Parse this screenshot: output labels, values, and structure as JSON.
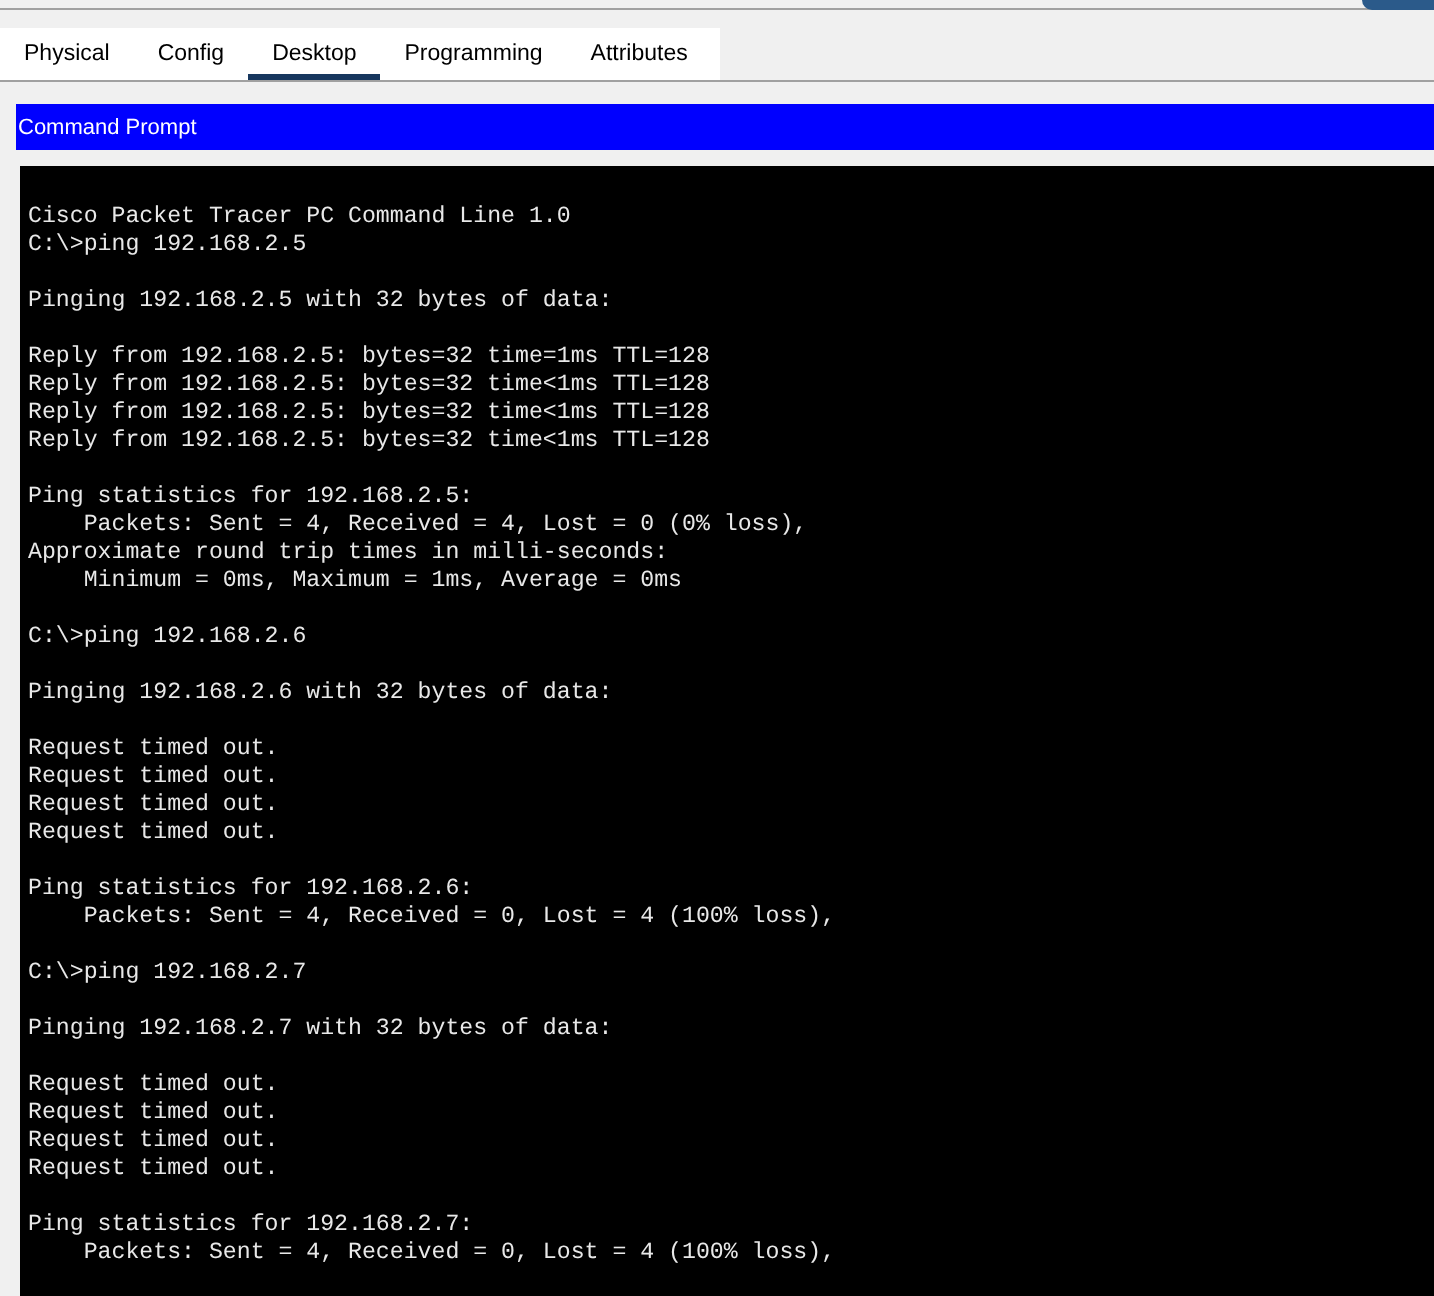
{
  "tabs": [
    {
      "label": "Physical",
      "selected": false
    },
    {
      "label": "Config",
      "selected": false
    },
    {
      "label": "Desktop",
      "selected": true
    },
    {
      "label": "Programming",
      "selected": false
    },
    {
      "label": "Attributes",
      "selected": false
    }
  ],
  "panel": {
    "title": "Command Prompt"
  },
  "terminal": {
    "blocks": [
      [
        "Cisco Packet Tracer PC Command Line 1.0",
        "C:\\>ping 192.168.2.5"
      ],
      [
        "Pinging 192.168.2.5 with 32 bytes of data:"
      ],
      [
        "Reply from 192.168.2.5: bytes=32 time=1ms TTL=128",
        "Reply from 192.168.2.5: bytes=32 time<1ms TTL=128",
        "Reply from 192.168.2.5: bytes=32 time<1ms TTL=128",
        "Reply from 192.168.2.5: bytes=32 time<1ms TTL=128"
      ],
      [
        "Ping statistics for 192.168.2.5:",
        "    Packets: Sent = 4, Received = 4, Lost = 0 (0% loss),",
        "Approximate round trip times in milli-seconds:",
        "    Minimum = 0ms, Maximum = 1ms, Average = 0ms"
      ],
      [
        "C:\\>ping 192.168.2.6"
      ],
      [
        "Pinging 192.168.2.6 with 32 bytes of data:"
      ],
      [
        "Request timed out.",
        "Request timed out.",
        "Request timed out.",
        "Request timed out."
      ],
      [
        "Ping statistics for 192.168.2.6:",
        "    Packets: Sent = 4, Received = 0, Lost = 4 (100% loss),"
      ],
      [
        "C:\\>ping 192.168.2.7"
      ],
      [
        "Pinging 192.168.2.7 with 32 bytes of data:"
      ],
      [
        "Request timed out.",
        "Request timed out.",
        "Request timed out.",
        "Request timed out."
      ],
      [
        "Ping statistics for 192.168.2.7:",
        "    Packets: Sent = 4, Received = 0, Lost = 4 (100% loss),"
      ]
    ]
  }
}
